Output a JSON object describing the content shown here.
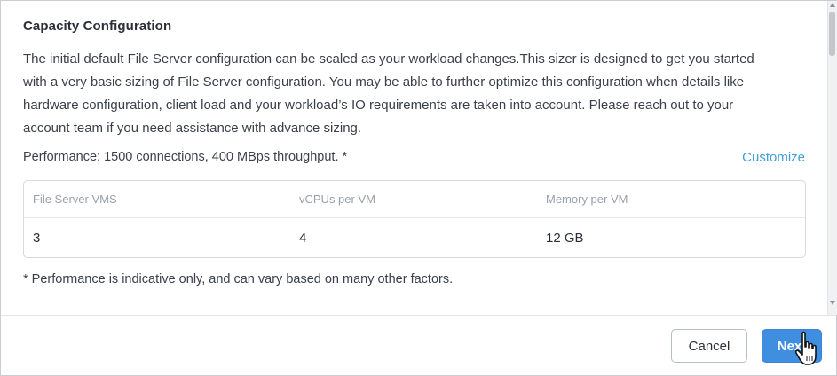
{
  "dialog": {
    "title": "Capacity Configuration",
    "description_lines": [
      "The initial default File Server configuration can be scaled as your workload changes.This sizer is designed to get you started",
      "with a very basic sizing of File Server configuration. You may be able to further optimize this configuration when details like",
      "hardware configuration, client load and your workload’s IO requirements are taken into account. Please reach out to your",
      "account team if you need assistance with advance sizing."
    ],
    "performance_text": "Performance: 1500 connections, 400 MBps throughput. *",
    "customize_label": "Customize",
    "table": {
      "headers": [
        "File Server VMS",
        "vCPUs per VM",
        "Memory per VM"
      ],
      "row": [
        "3",
        "4",
        "12 GB"
      ]
    },
    "footnote": "* Performance is indicative only, and can vary based on many other factors."
  },
  "footer": {
    "cancel_label": "Cancel",
    "next_label": "Next"
  },
  "colors": {
    "accent": "#3f8ee0",
    "link": "#3f9fd8"
  },
  "icons": {
    "cursor": "hand-pointer-icon"
  }
}
